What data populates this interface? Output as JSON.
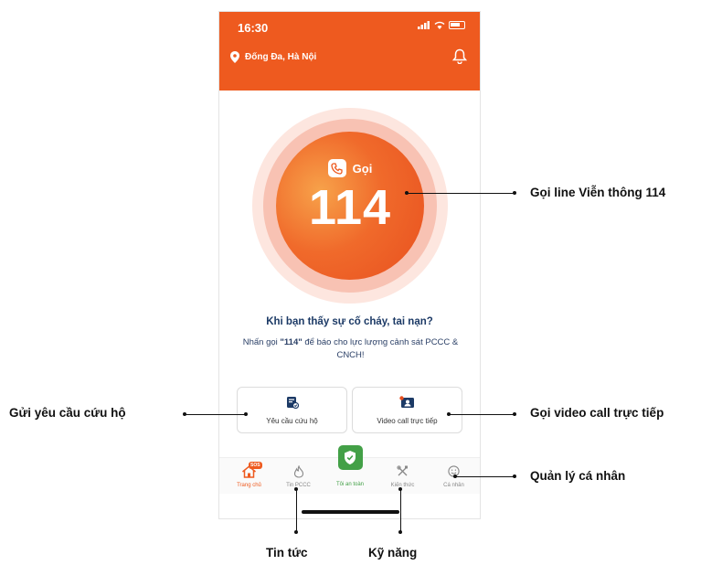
{
  "status_bar": {
    "time": "16:30"
  },
  "header": {
    "location": "Đống Đa, Hà Nội"
  },
  "sos": {
    "call_label": "Gọi",
    "number": "114"
  },
  "prompt": {
    "question": "Khi bạn thấy sự cố cháy, tai nạn?",
    "instruction_prefix": "Nhấn gọi ",
    "instruction_number": "\"114\"",
    "instruction_suffix": " để báo cho lực lượng cảnh sát PCCC & CNCH!"
  },
  "actions": {
    "rescue_label": "Yêu cầu cứu hộ",
    "video_label": "Video call trực tiếp"
  },
  "nav": {
    "home": "Trang chủ",
    "sos_tag": "SOS",
    "news": "Tin PCCC",
    "safe": "Tôi an toàn",
    "knowledge": "Kiến thức",
    "profile": "Cá nhân"
  },
  "callouts": {
    "call_114": "Gọi line Viễn thông 114",
    "rescue_request": "Gửi yêu cầu cứu hộ",
    "video_call": "Gọi video call trực tiếp",
    "personal": "Quản lý cá nhân",
    "news": "Tin tức",
    "skills": "Kỹ năng"
  },
  "colors": {
    "brand": "#ee5a1f",
    "safe": "#43a047",
    "text_dark": "#1c3a66"
  },
  "icons": [
    "location-pin-icon",
    "bell-icon",
    "phone-icon",
    "rescue-request-icon",
    "video-call-icon",
    "home-icon",
    "flame-icon",
    "shield-check-icon",
    "tools-icon",
    "smiley-icon"
  ]
}
